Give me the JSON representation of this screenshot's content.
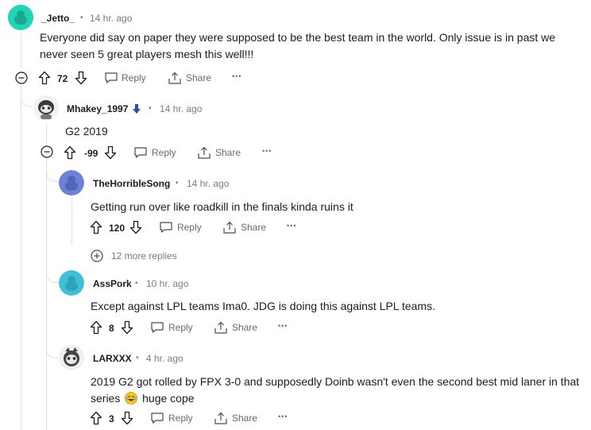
{
  "comments": [
    {
      "author": "_Jetto_",
      "time": "14 hr. ago",
      "body": "Everyone did say on paper they were supposed to be the best team in the world. Only issue is in past we never seen 5 great players mesh this well!!!",
      "score": "72",
      "reply_label": "Reply",
      "share_label": "Share",
      "avatar_color": "#23d3b6"
    },
    {
      "author": "Mhakey_1997",
      "time": "14 hr. ago",
      "body": "G2 2019",
      "score": "-99",
      "reply_label": "Reply",
      "share_label": "Share",
      "flair_color": "#2d4fa0"
    },
    {
      "author": "TheHorribleSong",
      "time": "14 hr. ago",
      "body": "Getting run over like roadkill in the finals kinda ruins it",
      "score": "120",
      "reply_label": "Reply",
      "share_label": "Share",
      "avatar_color": "#6b82d6",
      "more_replies": "12 more replies"
    },
    {
      "author": "AssPork",
      "time": "10 hr. ago",
      "body": "Except against LPL teams Ima0. JDG is doing this against LPL teams.",
      "score": "8",
      "reply_label": "Reply",
      "share_label": "Share",
      "avatar_color": "#3fc0d6"
    },
    {
      "author": "LARXXX",
      "time": "4 hr. ago",
      "body_part1": "2019 G2 got rolled by FPX 3-0 and supposedly Doinb wasn't even the second best mid laner in that series",
      "body_part2": "huge cope",
      "score": "3",
      "reply_label": "Reply",
      "share_label": "Share"
    }
  ],
  "separator": "•",
  "overflow_label": "•••"
}
